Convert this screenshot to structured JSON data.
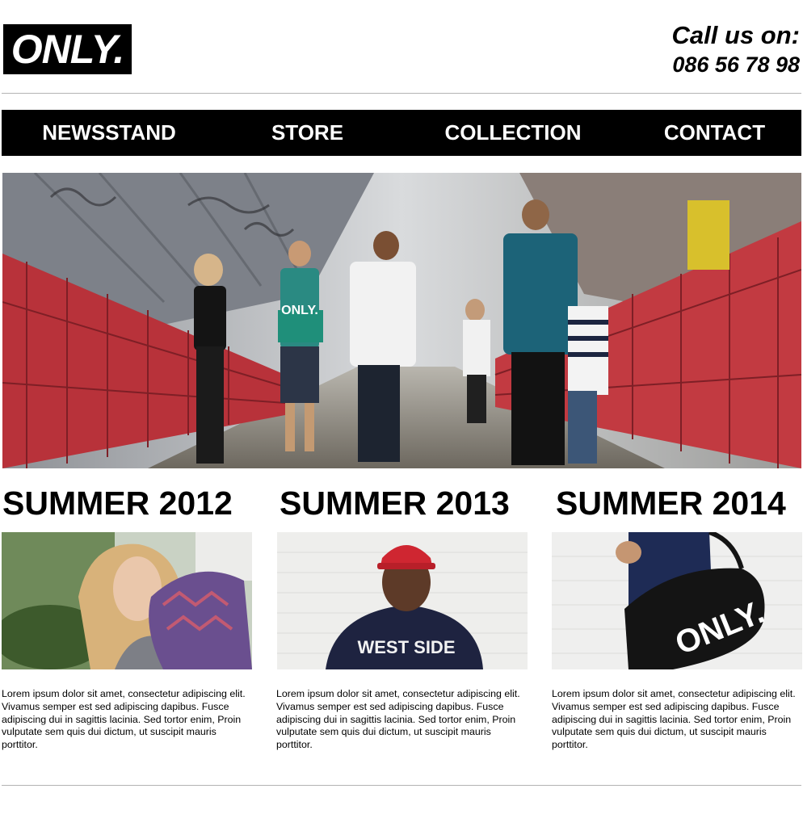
{
  "header": {
    "logo": "ONLY.",
    "call_label": "Call us on:",
    "phone": "086 56 78 98"
  },
  "nav": {
    "items": [
      {
        "label": "NEWSSTAND"
      },
      {
        "label": "STORE"
      },
      {
        "label": "COLLECTION"
      },
      {
        "label": "CONTACT"
      }
    ]
  },
  "hero": {
    "shirt_print": "ONLY."
  },
  "columns": [
    {
      "title": "SUMMER 2012",
      "text": "Lorem ipsum dolor sit amet, consectetur adipiscing elit. Vivamus semper est sed adipiscing dapibus. Fusce adipiscing dui in sagittis lacinia. Sed tortor enim,  Proin vulputate sem quis dui dictum, ut suscipit mauris porttitor."
    },
    {
      "title": "SUMMER 2013",
      "text": "Lorem ipsum dolor sit amet, consectetur adipiscing elit. Vivamus semper est sed adipiscing dapibus. Fusce adipiscing dui in sagittis lacinia. Sed tortor enim,  Proin vulputate sem quis dui dictum, ut suscipit mauris porttitor.",
      "shirt_print": "WEST SIDE"
    },
    {
      "title": "SUMMER 2014",
      "text": "Lorem ipsum dolor sit amet, consectetur adipiscing elit. Vivamus semper est sed adipiscing dapibus. Fusce adipiscing dui in sagittis lacinia. Sed tortor enim,  Proin vulputate sem quis dui dictum, ut suscipit mauris porttitor.",
      "bag_print": "ONLY."
    }
  ],
  "colors": {
    "nav_bg": "#000000",
    "nav_text": "#ffffff",
    "rule": "#b3b3b3",
    "railing_red": "#b8323a"
  }
}
